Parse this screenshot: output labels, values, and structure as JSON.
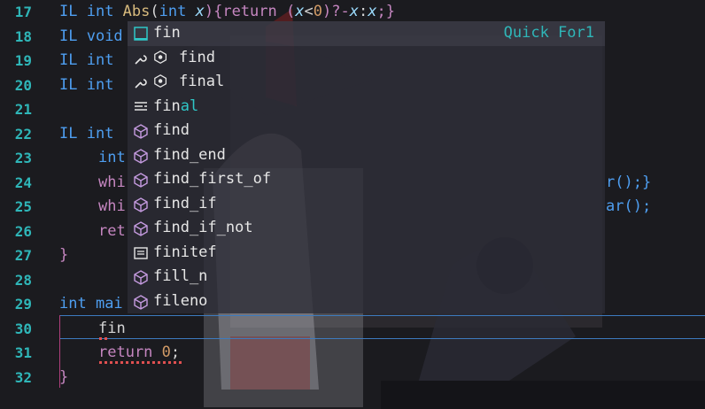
{
  "gutter": {
    "line_numbers": [
      "17",
      "18",
      "19",
      "20",
      "21",
      "22",
      "23",
      "24",
      "25",
      "26",
      "27",
      "28",
      "29",
      "30",
      "31",
      "32"
    ]
  },
  "code": {
    "l17": {
      "a": "IL ",
      "b": "int ",
      "c": "Abs",
      "d": "(",
      "e": "int ",
      "f": "x",
      "g": "){",
      "h": "return ",
      "i": "(",
      "j": "x",
      "k": "<",
      "l": "0",
      "m": ")?-",
      "n": "x",
      "o": ":",
      "p": "x",
      "q": ";}"
    },
    "l18": {
      "a": "IL ",
      "b": "void"
    },
    "l19": {
      "a": "IL ",
      "b": "int"
    },
    "l20": {
      "a": "IL ",
      "b": "int"
    },
    "l22": {
      "a": "IL ",
      "b": "int"
    },
    "l23": {
      "a": "int"
    },
    "l24": {
      "a": "whi",
      "b": "r();}"
    },
    "l25": {
      "a": "whi",
      "b": "ar();"
    },
    "l26": {
      "a": "ret"
    },
    "l27": {
      "a": "}"
    },
    "l29": {
      "a": "int ",
      "b": "mai"
    },
    "l30": {
      "a": "fin"
    },
    "l31": {
      "a": "return ",
      "b": "0",
      "c": ";"
    },
    "l32": {
      "a": "}"
    }
  },
  "suggest": {
    "detail": "Quick For1",
    "items": [
      {
        "icon": "snippet-icon",
        "prefix": "",
        "match": "",
        "label": "fin",
        "selected": true
      },
      {
        "icon": "wrench-module-icon",
        "prefix": "",
        "match": "",
        "label": "find"
      },
      {
        "icon": "wrench-module-icon",
        "prefix": "",
        "match": "",
        "label": "final"
      },
      {
        "icon": "keyword-icon",
        "prefix": "fin",
        "match": "al",
        "label": ""
      },
      {
        "icon": "cube-icon",
        "prefix": "",
        "match": "",
        "label": "find"
      },
      {
        "icon": "cube-icon",
        "prefix": "",
        "match": "",
        "label": "find_end"
      },
      {
        "icon": "cube-icon",
        "prefix": "",
        "match": "",
        "label": "find_first_of"
      },
      {
        "icon": "cube-icon",
        "prefix": "",
        "match": "",
        "label": "find_if"
      },
      {
        "icon": "cube-icon",
        "prefix": "",
        "match": "",
        "label": "find_if_not"
      },
      {
        "icon": "text-icon",
        "prefix": "",
        "match": "",
        "label": "finitef"
      },
      {
        "icon": "cube-icon",
        "prefix": "",
        "match": "",
        "label": "fill_n"
      },
      {
        "icon": "cube-icon",
        "prefix": "",
        "match": "",
        "label": "fileno"
      }
    ]
  },
  "colors": {
    "line_number": "#2fb6b8",
    "keyword": "#4e9ef0",
    "control": "#c586c0",
    "function": "#d7ba7d",
    "param": "#9cdcfe",
    "number": "#d19a66",
    "highlight": "#2fc7c7"
  }
}
